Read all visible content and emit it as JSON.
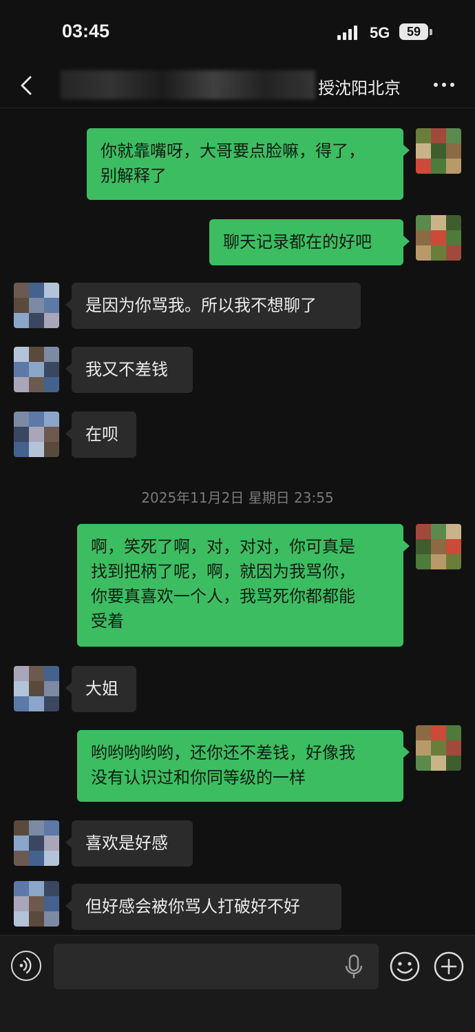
{
  "status_bar": {
    "time": "03:45",
    "network": "5G",
    "battery": "59"
  },
  "nav": {
    "title": "授沈阳北京"
  },
  "messages": [
    {
      "side": "out",
      "lines": [
        "你就靠嘴呀，大哥要点脸嘛，得了，",
        "别解释了"
      ]
    },
    {
      "side": "out",
      "lines": [
        "聊天记录都在的好吧"
      ]
    },
    {
      "side": "in",
      "lines": [
        "是因为你骂我。所以我不想聊了"
      ]
    },
    {
      "side": "in",
      "lines": [
        "我又不差钱"
      ]
    },
    {
      "side": "in",
      "lines": [
        "在呗"
      ]
    },
    {
      "side": "out",
      "lines": [
        "啊，笑死了啊，对，对对，你可真是",
        "找到把柄了呢，啊，就因为我骂你，",
        "你要真喜欢一个人，我骂死你都都能",
        "受着"
      ]
    },
    {
      "side": "in",
      "lines": [
        "大姐"
      ]
    },
    {
      "side": "out",
      "lines": [
        "哟哟哟哟哟，还你还不差钱，好像我",
        "没有认识过和你同等级的一样"
      ]
    },
    {
      "side": "in",
      "lines": [
        "喜欢是好感"
      ]
    },
    {
      "side": "in",
      "lines": [
        "但好感会被你骂人打破好不好"
      ]
    }
  ],
  "timestamp": "2025年11月2日 星期日 23:55",
  "input": {
    "value": "",
    "placeholder": ""
  },
  "icons": {
    "back": "chevron-left-icon",
    "more": "more-dots-icon",
    "voice": "voice-icon",
    "mic": "microphone-icon",
    "emoji": "emoji-icon",
    "plus": "plus-icon"
  },
  "colors": {
    "outgoing_bubble": "#3dbd62",
    "incoming_bubble": "#2b2b2b",
    "background": "#111111"
  }
}
